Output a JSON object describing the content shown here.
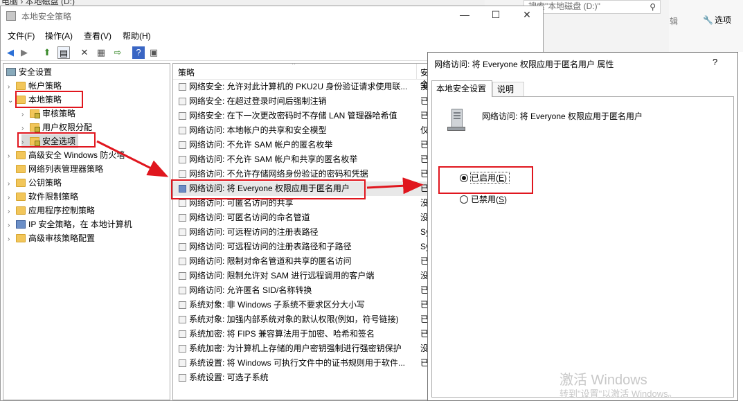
{
  "background": {
    "breadcrumb_fragment": "电脑 › 本地磁盘 (D:)",
    "search_placeholder": "搜索\"本地磁盘 (D:)\"",
    "options_label": "选项",
    "edit_fragment": "辑",
    "top_right_fragment": "此文件"
  },
  "window": {
    "title": "本地安全策略",
    "minimize": "—",
    "maximize": "☐",
    "close": "✕"
  },
  "menu": {
    "file": "文件(F)",
    "action": "操作(A)",
    "view": "查看(V)",
    "help": "帮助(H)"
  },
  "tree": {
    "items": [
      {
        "label": "安全设置"
      },
      {
        "label": "帐户策略"
      },
      {
        "label": "本地策略"
      },
      {
        "label": "审核策略"
      },
      {
        "label": "用户权限分配"
      },
      {
        "label": "安全选项"
      },
      {
        "label": "高级安全 Windows 防火墙"
      },
      {
        "label": "网络列表管理器策略"
      },
      {
        "label": "公钥策略"
      },
      {
        "label": "软件限制策略"
      },
      {
        "label": "应用程序控制策略"
      },
      {
        "label": "IP 安全策略，在 本地计算机"
      },
      {
        "label": "高级审核策略配置"
      }
    ]
  },
  "list": {
    "col_policy": "策略",
    "col_setting": "安全",
    "rows": [
      {
        "name": "网络安全: 允许对此计算机的 PKU2U 身份验证请求使用联...",
        "status": "没"
      },
      {
        "name": "网络安全: 在超过登录时间后强制注销",
        "status": "已"
      },
      {
        "name": "网络安全: 在下一次更改密码时不存储 LAN 管理器哈希值",
        "status": "已"
      },
      {
        "name": "网络访问: 本地帐户的共享和安全模型",
        "status": "仅"
      },
      {
        "name": "网络访问: 不允许 SAM 帐户的匿名枚举",
        "status": "已"
      },
      {
        "name": "网络访问: 不允许 SAM 帐户和共享的匿名枚举",
        "status": "已"
      },
      {
        "name": "网络访问: 不允许存储网络身份验证的密码和凭据",
        "status": "已"
      },
      {
        "name": "网络访问: 将 Everyone 权限应用于匿名用户",
        "status": "已"
      },
      {
        "name": "网络访问: 可匿名访问的共享",
        "status": "没"
      },
      {
        "name": "网络访问: 可匿名访问的命名管道",
        "status": "没"
      },
      {
        "name": "网络访问: 可远程访问的注册表路径",
        "status": "Sy"
      },
      {
        "name": "网络访问: 可远程访问的注册表路径和子路径",
        "status": "Sy"
      },
      {
        "name": "网络访问: 限制对命名管道和共享的匿名访问",
        "status": "已"
      },
      {
        "name": "网络访问: 限制允许对 SAM 进行远程调用的客户端",
        "status": "没"
      },
      {
        "name": "网络访问: 允许匿名 SID/名称转换",
        "status": "已"
      },
      {
        "name": "系统对象: 非 Windows 子系统不要求区分大小写",
        "status": "已"
      },
      {
        "name": "系统对象: 加强内部系统对象的默认权限(例如，符号链接)",
        "status": "已"
      },
      {
        "name": "系统加密: 将 FIPS 兼容算法用于加密、哈希和签名",
        "status": "已"
      },
      {
        "name": "系统加密: 为计算机上存储的用户密钥强制进行强密钥保护",
        "status": "没"
      },
      {
        "name": "系统设置: 将 Windows 可执行文件中的证书规则用于软件...",
        "status": "已"
      },
      {
        "name": "系统设置: 可选子系统",
        "status": ""
      }
    ]
  },
  "dialog": {
    "title": "网络访问: 将 Everyone 权限应用于匿名用户 属性",
    "help": "?",
    "tab_local": "本地安全设置",
    "tab_explain": "说明",
    "policy_name": "网络访问: 将 Everyone 权限应用于匿名用户",
    "enabled_label": "已启用",
    "enabled_key": "E",
    "disabled_label": "已禁用",
    "disabled_key": "S",
    "selected": "enabled"
  },
  "watermark": {
    "line1": "激活 Windows",
    "line2": "转到\"设置\"以激活 Windows。"
  },
  "colors": {
    "annotation_red": "#e0161e",
    "selected_row": "#e8e8e8"
  }
}
